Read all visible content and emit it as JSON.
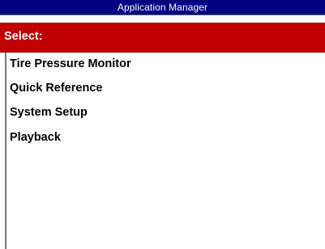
{
  "window": {
    "title": "Application Manager"
  },
  "header": {
    "label": "Select:"
  },
  "menu": {
    "items": [
      {
        "label": "Tire Pressure Monitor"
      },
      {
        "label": "Quick Reference"
      },
      {
        "label": "System Setup"
      },
      {
        "label": "Playback"
      }
    ]
  },
  "colors": {
    "titlebar_bg": "#000080",
    "header_bg": "#c00000",
    "list_bg": "#ffffff",
    "text": "#000000"
  }
}
